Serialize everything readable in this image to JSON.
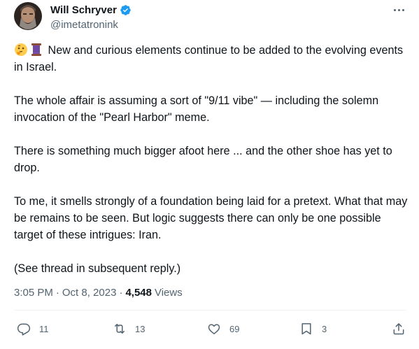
{
  "author": {
    "display_name": "Will Schryver",
    "handle": "@imetatronink",
    "verified_icon": "verified-badge-icon",
    "avatar_icon": "avatar"
  },
  "tweet": {
    "emoji_icons": [
      "thinking-face-emoji",
      "spool-of-thread-emoji"
    ],
    "paragraphs": [
      "New and curious elements continue to be added to the evolving events in Israel.",
      "The whole affair is assuming a sort of \"9/11 vibe\" — including the solemn invocation of the \"Pearl Harbor\" meme.",
      "There is something much bigger afoot here ... and the other shoe has yet to drop.",
      "To me, it smells strongly of a foundation being laid for a pretext. What that may be remains to be seen. But logic suggests there can only be one possible target of these intrigues: Iran.",
      "(See thread in subsequent reply.)"
    ]
  },
  "meta": {
    "time": "3:05 PM",
    "date": "Oct 8, 2023",
    "views_count": "4,548",
    "views_label": "Views",
    "separator": "·"
  },
  "actions": {
    "replies": "11",
    "reposts": "13",
    "likes": "69",
    "bookmarks": "3"
  },
  "colors": {
    "text": "#0f1419",
    "secondary": "#536471",
    "verified": "#1d9bf0",
    "divider": "#eff3f4"
  }
}
